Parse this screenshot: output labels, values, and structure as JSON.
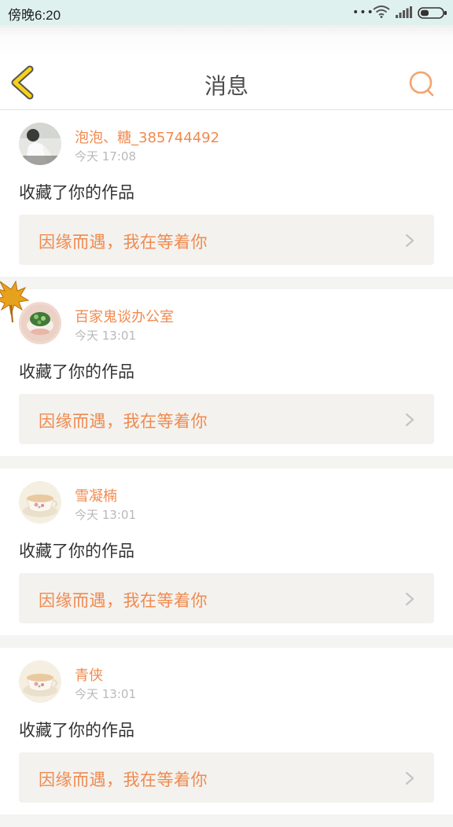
{
  "status_bar": {
    "time": "傍晚6:20",
    "dots": "•••"
  },
  "header": {
    "title": "消息",
    "back_icon": "chevron-left-icon",
    "search_icon": "search-icon"
  },
  "messages": [
    {
      "user": "泡泡、糖_385744492",
      "time": "今天 17:08",
      "action": "收藏了你的作品",
      "work": "因缘而遇，我在等着你",
      "avatar": "avatar-photo-1"
    },
    {
      "user": "百家鬼谈办公室",
      "time": "今天 13:01",
      "action": "收藏了你的作品",
      "work": "因缘而遇，我在等着你",
      "avatar": "avatar-photo-2"
    },
    {
      "user": "雪凝楠",
      "time": "今天 13:01",
      "action": "收藏了你的作品",
      "work": "因缘而遇，我在等着你",
      "avatar": "avatar-teacup"
    },
    {
      "user": "青侠",
      "time": "今天 13:01",
      "action": "收藏了你的作品",
      "work": "因缘而遇，我在等着你",
      "avatar": "avatar-teacup"
    }
  ],
  "colors": {
    "accent": "#f08a50",
    "back_icon": "#f5c400",
    "status_bar_bg": "#dff1ef"
  }
}
